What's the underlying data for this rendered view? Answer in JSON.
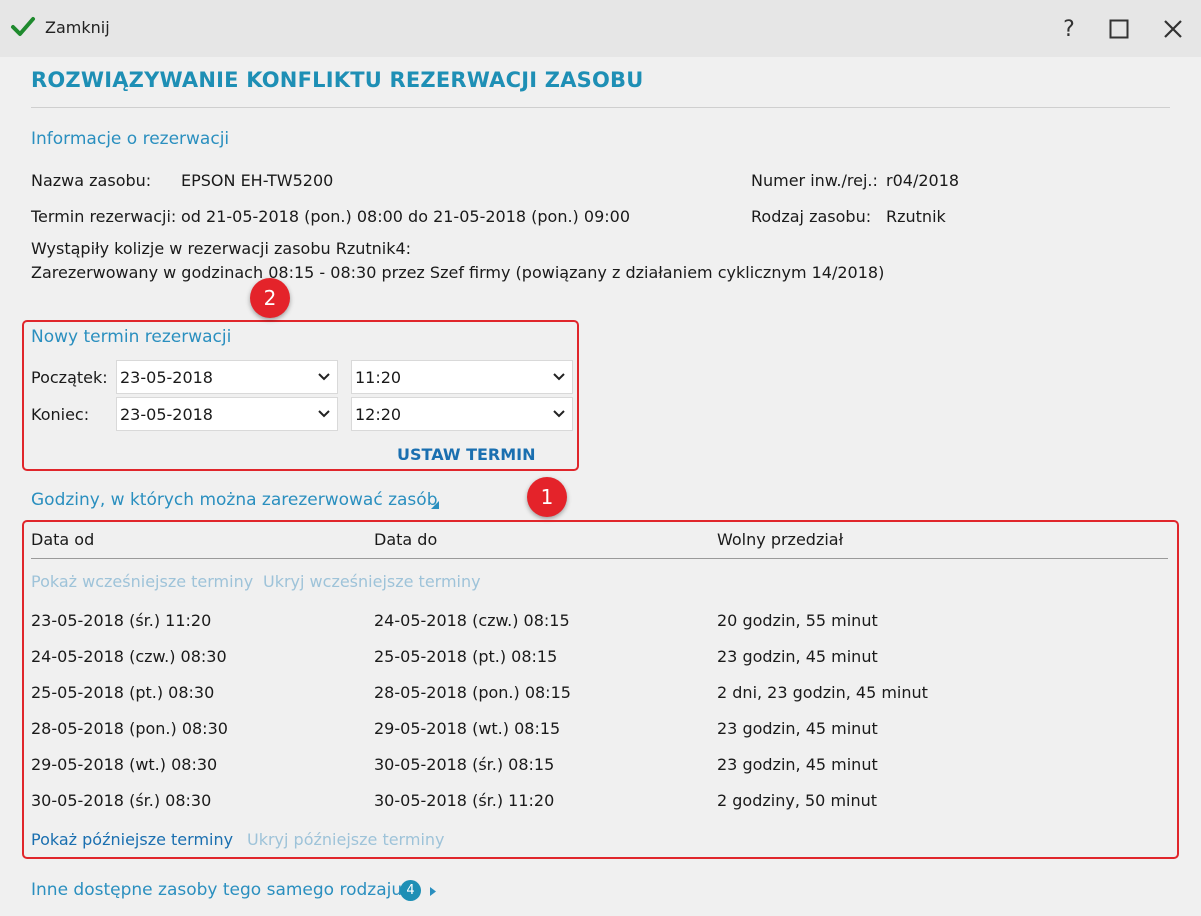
{
  "titlebar": {
    "close_label": "Zamknij",
    "help_glyph": "?"
  },
  "page_title": "ROZWIĄZYWANIE KONFLIKTU REZERWACJI ZASOBU",
  "info": {
    "heading": "Informacje o rezerwacji",
    "resource_name_label": "Nazwa zasobu:",
    "resource_name_value": "EPSON EH-TW5200",
    "inv_label": "Numer inw./rej.:",
    "inv_value": "r04/2018",
    "term_label": "Termin rezerwacji:",
    "term_value": "od 21-05-2018 (pon.) 08:00 do 21-05-2018 (pon.) 09:00",
    "type_label": "Rodzaj zasobu:",
    "type_value": "Rzutnik",
    "conflict_line1": "Wystąpiły kolizje w rezerwacji zasobu Rzutnik4:",
    "conflict_line2": "Zarezerwowany w godzinach 08:15 - 08:30 przez Szef firmy (powiązany z działaniem cyklicznym 14/2018)"
  },
  "new_term": {
    "heading": "Nowy termin rezerwacji",
    "start_label": "Początek:",
    "start_date": "23-05-2018",
    "start_time": "11:20",
    "end_label": "Koniec:",
    "end_date": "23-05-2018",
    "end_time": "12:20",
    "set_button": "USTAW TERMIN"
  },
  "annotations": {
    "badge_1": "1",
    "badge_2": "2"
  },
  "availability": {
    "heading": "Godziny, w których można zarezerwować zasób",
    "columns": [
      "Data od",
      "Data do",
      "Wolny przedział"
    ],
    "show_earlier": "Pokaż wcześniejsze terminy",
    "hide_earlier": "Ukryj wcześniejsze terminy",
    "rows": [
      [
        "23-05-2018 (śr.) 11:20",
        "24-05-2018 (czw.) 08:15",
        "20 godzin, 55 minut"
      ],
      [
        "24-05-2018 (czw.) 08:30",
        "25-05-2018 (pt.) 08:15",
        "23 godzin, 45 minut"
      ],
      [
        "25-05-2018 (pt.) 08:30",
        "28-05-2018 (pon.) 08:15",
        "2 dni, 23 godzin, 45 minut"
      ],
      [
        "28-05-2018 (pon.) 08:30",
        "29-05-2018 (wt.) 08:15",
        "23 godzin, 45 minut"
      ],
      [
        "29-05-2018 (wt.) 08:30",
        "30-05-2018 (śr.) 08:15",
        "23 godzin, 45 minut"
      ],
      [
        "30-05-2018 (śr.) 08:30",
        "30-05-2018 (śr.) 11:20",
        "2 godziny, 50 minut"
      ]
    ],
    "show_later": "Pokaż późniejsze terminy",
    "hide_later": "Ukryj późniejsze terminy"
  },
  "other_resources": {
    "label": "Inne dostępne zasoby tego samego rodzaju",
    "count": "4"
  },
  "colors": {
    "accent": "#1e8fb5",
    "link": "#1a6fb0",
    "annotation": "#e4232a",
    "check": "#1f8a2e"
  }
}
